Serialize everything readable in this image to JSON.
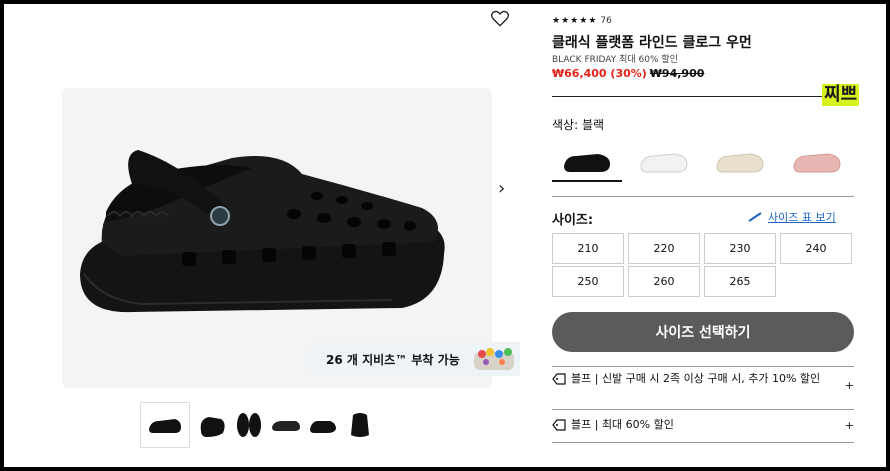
{
  "product": {
    "rating_count": "76",
    "title": "클래식 플랫폼 라인드 클로그 우먼",
    "promo": "BLACK FRIDAY 최대 60% 할인",
    "sale_price": "₩66,400 (30%)",
    "original_price": "₩94,900"
  },
  "badge": "찌쁘",
  "color": {
    "label": "색상: 블랙",
    "options": [
      "black",
      "white",
      "bone",
      "pink"
    ],
    "selected": "black"
  },
  "size": {
    "label": "사이즈:",
    "guide_link": "사이즈 표 보기",
    "options": [
      "210",
      "220",
      "230",
      "240",
      "250",
      "260",
      "265"
    ]
  },
  "cta": {
    "label": "사이즈 선택하기"
  },
  "gallery": {
    "jibbitz_label": "26 개 지비츠™ 부착 가능",
    "next_arrow": "›"
  },
  "accordions": [
    {
      "text": "블프 | 신발 구매 시 2족 이상 구매 시, 추가 10% 할인",
      "icon": "tag-icon",
      "action": "+"
    },
    {
      "text": "블프 | 최대 60% 할인",
      "icon": "tag-icon",
      "action": "+"
    }
  ],
  "colors": {
    "sale": "#e2231a",
    "cta_bg": "#595b5c",
    "link": "#1f63c6",
    "badge_bg": "#d8f21e"
  }
}
